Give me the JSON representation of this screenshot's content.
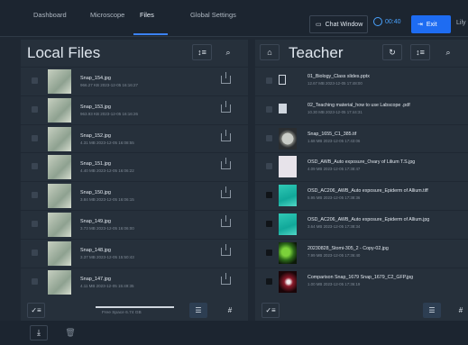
{
  "nav": {
    "tabs": [
      "Dashboard",
      "Microscope",
      "Files",
      "Global Settings"
    ],
    "chat_button": "Chat Window",
    "timer": "00:40",
    "exit_button": "Exit",
    "user": "Lily"
  },
  "left_panel": {
    "title": "Local Files",
    "files": [
      {
        "name": "Snap_154.jpg",
        "meta": "966.27 KB 2023-12-05 16:16:27"
      },
      {
        "name": "Snap_153.jpg",
        "meta": "963.93 KB 2023-12-05 16:16:26"
      },
      {
        "name": "Snap_152.jpg",
        "meta": "4.31 MB 2023-12-05 16:08:55"
      },
      {
        "name": "Snap_151.jpg",
        "meta": "4.40 MB 2023-12-05 16:06:22"
      },
      {
        "name": "Snap_150.jpg",
        "meta": "3.84 MB 2023-12-05 16:06:15"
      },
      {
        "name": "Snap_149.jpg",
        "meta": "3.73 MB 2023-12-05 16:06:00"
      },
      {
        "name": "Snap_148.jpg",
        "meta": "3.37 MB 2023-12-05 15:50:43"
      },
      {
        "name": "Snap_147.jpg",
        "meta": "4.11 MB 2023-12-05 15:49:35"
      }
    ],
    "free_space": "Free Space 6.74 GB",
    "free_space_fraction": 0.92
  },
  "right_panel": {
    "title": "Teacher",
    "files": [
      {
        "name": "01_Biology_Class slides.pptx",
        "meta": "12.67 MB 2023-12-05 17:48:00",
        "thumb": "doc"
      },
      {
        "name": "02_Teaching material_how to use Labscope .pdf",
        "meta": "10.30 MB 2023-12-05 17:44:31",
        "thumb": "pdf"
      },
      {
        "name": "Snap_1655_C1_385.tif",
        "meta": "1.68 MB 2023-12-05 17:43:06",
        "thumb": "round"
      },
      {
        "name": "OSD_AWB_Auto exposure_Ovary of Lilium T.S.jpg",
        "meta": "4.09 MB 2023-12-05 17:38:47",
        "thumb": "violet"
      },
      {
        "name": "OSD_AC206_AWB_Auto exposure_Epiderm of Allium.tiff",
        "meta": "5.95 MB 2023-12-05 17:38:36",
        "thumb": "teal"
      },
      {
        "name": "OSD_AC206_AWB_Auto exposure_Epiderm of Allium.jpg",
        "meta": "3.64 MB 2023-12-05 17:38:34",
        "thumb": "teal"
      },
      {
        "name": "20230828_Stomi-305_2 - Copy-02.jpg",
        "meta": "7.99 MB 2023-12-05 17:36:40",
        "thumb": "green"
      },
      {
        "name": "Comparison Snap_1679 Snap_1679_C2_GFP.jpg",
        "meta": "1.00 MB 2023-12-05 17:36:19",
        "thumb": "red"
      }
    ]
  },
  "colors": {
    "accent": "#1e6cf2",
    "background": "#1f2833",
    "panel": "#26303b"
  }
}
